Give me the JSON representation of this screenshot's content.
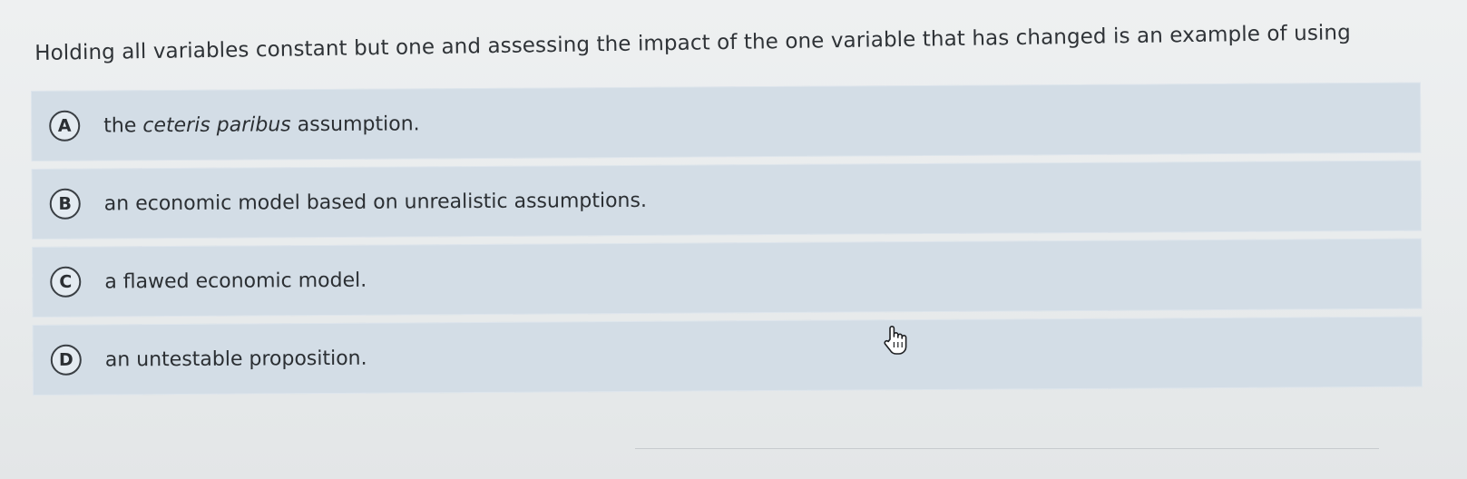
{
  "question": {
    "text": "Holding all variables constant but one and assessing the impact of the one variable that has changed is an example of using"
  },
  "choices": [
    {
      "letter": "A",
      "text_before": "the ",
      "text_italic": "ceteris paribus",
      "text_after": " assumption."
    },
    {
      "letter": "B",
      "text": "an economic model based on unrealistic assumptions."
    },
    {
      "letter": "C",
      "text": "a flawed economic model."
    },
    {
      "letter": "D",
      "text": "an untestable proposition."
    }
  ],
  "cursor": {
    "icon": "hand-pointer-icon"
  }
}
